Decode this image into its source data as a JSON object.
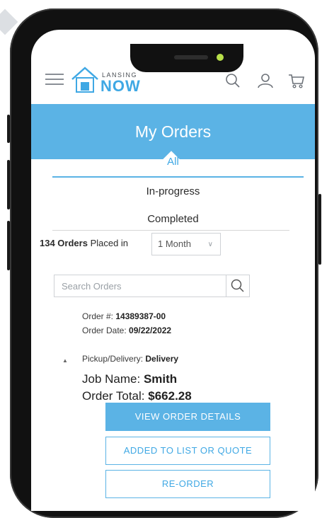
{
  "header": {
    "logo_small": "LANSING",
    "logo_big": "NOW",
    "icons": [
      "menu-icon",
      "search-icon",
      "user-icon",
      "cart-icon"
    ]
  },
  "page_title": "My Orders",
  "tabs": [
    {
      "label": "All",
      "active": true
    },
    {
      "label": "In-progress",
      "active": false
    },
    {
      "label": "Completed",
      "active": false
    }
  ],
  "orders_summary": {
    "count": "134 Orders",
    "placed_in": "Placed in",
    "period": "1 Month"
  },
  "search": {
    "placeholder": "Search Orders",
    "value": ""
  },
  "order": {
    "number_label": "Order #:",
    "number": "14389387-00",
    "date_label": "Order Date:",
    "date": "09/22/2022",
    "pickup_label": "Pickup/Delivery:",
    "pickup": "Delivery",
    "job_label": "Job Name:",
    "job": "Smith",
    "total_label": "Order Total:",
    "total": "$662.28"
  },
  "buttons": {
    "view": "VIEW ORDER DETAILS",
    "added": "ADDED TO LIST OR QUOTE",
    "reorder": "RE-ORDER"
  },
  "colors": {
    "accent": "#5bb3e5",
    "link": "#3fa8e4"
  }
}
